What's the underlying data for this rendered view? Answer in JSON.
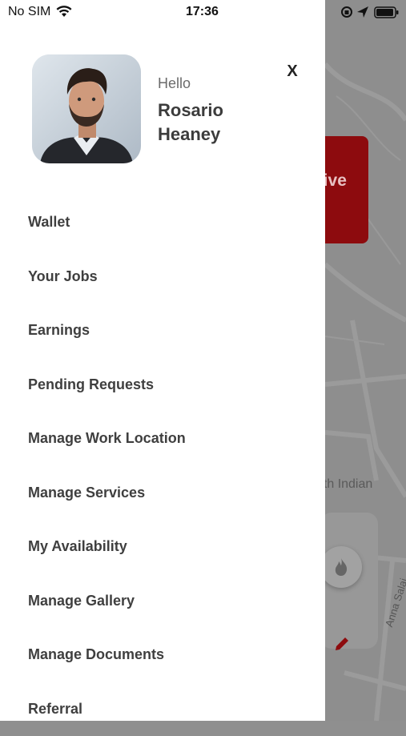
{
  "status_bar": {
    "carrier": "No SIM",
    "time": "17:36"
  },
  "drawer": {
    "greeting": "Hello",
    "user_name": "Rosario Heaney",
    "close_label": "X",
    "menu": [
      {
        "label": "Wallet"
      },
      {
        "label": "Your Jobs"
      },
      {
        "label": "Earnings"
      },
      {
        "label": "Pending Requests"
      },
      {
        "label": "Manage Work Location"
      },
      {
        "label": "Manage Services"
      },
      {
        "label": "My Availability"
      },
      {
        "label": "Manage Gallery"
      },
      {
        "label": "Manage Documents"
      },
      {
        "label": "Referral"
      }
    ]
  },
  "background": {
    "receive_button_partial": "eive",
    "restaurant_label_partial": "uth Indian",
    "road_label": "Anna Salai",
    "accent_color": "#8d0b0e"
  }
}
